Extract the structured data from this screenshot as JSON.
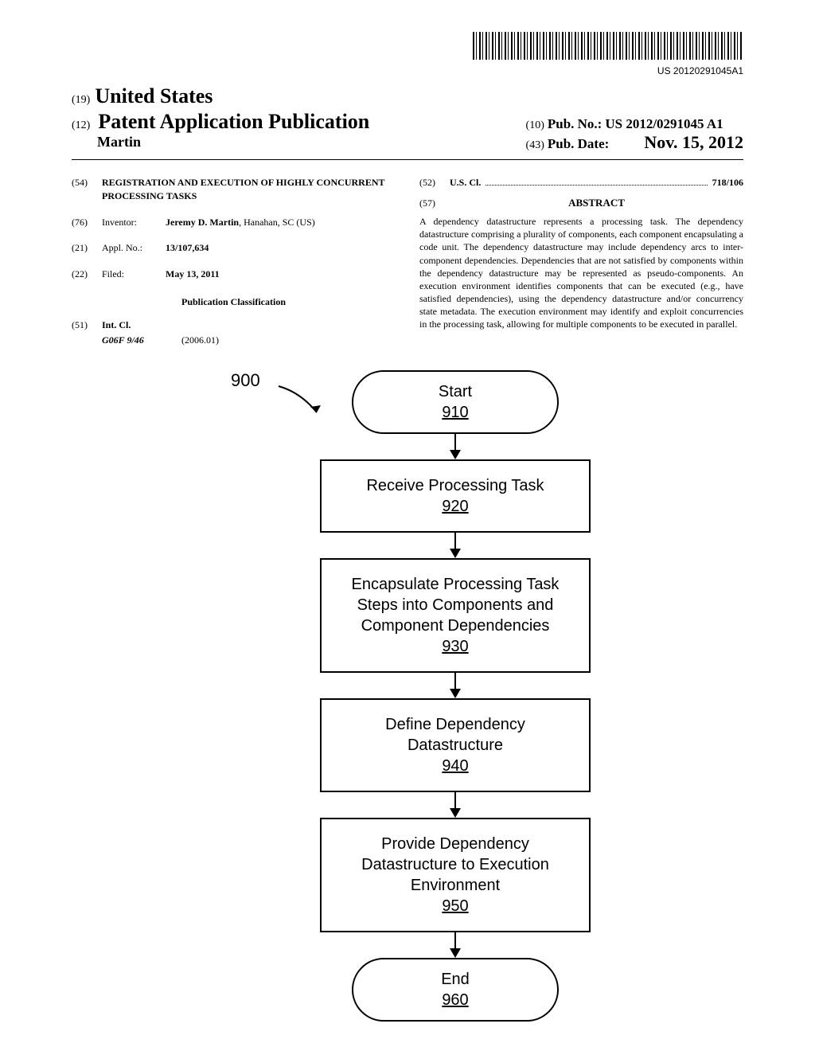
{
  "barcode_number": "US 20120291045A1",
  "header": {
    "code19": "(19)",
    "country": "United States",
    "code12": "(12)",
    "pub_type": "Patent Application Publication",
    "author": "Martin",
    "code10": "(10)",
    "pub_no_label": "Pub. No.:",
    "pub_no": "US 2012/0291045 A1",
    "code43": "(43)",
    "pub_date_label": "Pub. Date:",
    "pub_date": "Nov. 15, 2012"
  },
  "fields": {
    "title_code": "(54)",
    "title": "REGISTRATION AND EXECUTION OF HIGHLY CONCURRENT PROCESSING TASKS",
    "inventor_code": "(76)",
    "inventor_label": "Inventor:",
    "inventor_name": "Jeremy D. Martin",
    "inventor_loc": ", Hanahan, SC (US)",
    "appl_code": "(21)",
    "appl_label": "Appl. No.:",
    "appl_no": "13/107,634",
    "filed_code": "(22)",
    "filed_label": "Filed:",
    "filed_date": "May 13, 2011",
    "pub_class_heading": "Publication Classification",
    "intcl_code": "(51)",
    "intcl_label": "Int. Cl.",
    "intcl_value": "G06F 9/46",
    "intcl_year": "(2006.01)",
    "uscl_code": "(52)",
    "uscl_label": "U.S. Cl.",
    "uscl_value": "718/106",
    "abstract_code": "(57)",
    "abstract_label": "ABSTRACT",
    "abstract": "A dependency datastructure represents a processing task. The dependency datastructure comprising a plurality of components, each component encapsulating a code unit. The dependency datastructure may include dependency arcs to inter-component dependencies. Dependencies that are not satisfied by components within the dependency datastructure may be represented as pseudo-components. An execution environment identifies components that can be executed (e.g., have satisfied dependencies), using the dependency datastructure and/or concurrency state metadata. The execution environment may identify and exploit concurrencies in the processing task, allowing for multiple components to be executed in parallel."
  },
  "flowchart": {
    "label": "900",
    "nodes": [
      {
        "text": "Start",
        "num": "910",
        "type": "terminal"
      },
      {
        "text": "Receive Processing Task",
        "num": "920",
        "type": "process"
      },
      {
        "text": "Encapsulate Processing Task Steps into Components and Component Dependencies",
        "num": "930",
        "type": "process"
      },
      {
        "text": "Define Dependency Datastructure",
        "num": "940",
        "type": "process"
      },
      {
        "text": "Provide Dependency Datastructure to Execution Environment",
        "num": "950",
        "type": "process"
      },
      {
        "text": "End",
        "num": "960",
        "type": "terminal"
      }
    ]
  }
}
